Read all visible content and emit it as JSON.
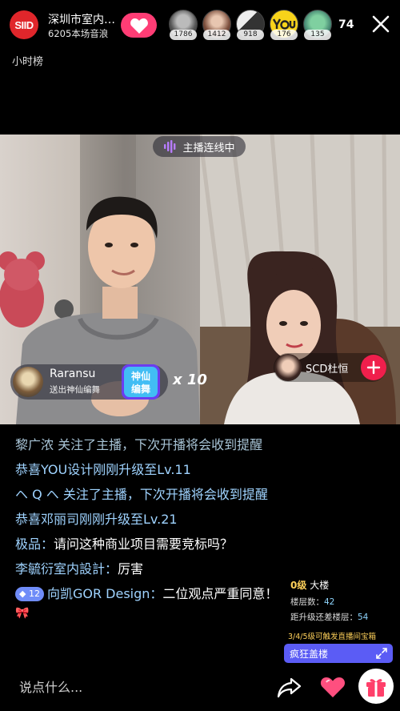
{
  "header": {
    "logo_text": "SIID",
    "host_name": "深圳市室内…",
    "host_sub": "6205本场音浪",
    "viewer_count": "74",
    "rank_label": "小时榜",
    "top_viewers": [
      {
        "badge": "1786",
        "icon": "avatar-user-1"
      },
      {
        "badge": "1412",
        "icon": "avatar-user-2"
      },
      {
        "badge": "918",
        "icon": "avatar-user-3"
      },
      {
        "badge": "176",
        "icon": "avatar-you-logo"
      },
      {
        "badge": "135",
        "icon": "avatar-user-5"
      }
    ]
  },
  "video": {
    "link_status": "主播连线中",
    "gift": {
      "sender": "Raransu",
      "desc": "送出神仙编舞",
      "gift_text": "神仙编舞",
      "count": "x 10"
    },
    "guest": {
      "name": "SCD杜恒"
    }
  },
  "chat": [
    {
      "name": "黎广浓 关注了主播，下次开播将会收到提醒",
      "text": "",
      "system": true,
      "dim": true
    },
    {
      "name": "恭喜YOU设计刚刚升级至Lv.11",
      "text": "",
      "system": true
    },
    {
      "name": "ヘ Q ヘ 关注了主播，下次开播将会收到提醒",
      "text": "",
      "system": true
    },
    {
      "name": "恭喜邓丽司刚刚升级至Lv.21",
      "text": "",
      "system": true
    },
    {
      "name": "极品：",
      "text": "请问这种商业项目需要竞标吗？",
      "system": false
    },
    {
      "name": "李毓衍室内設計：",
      "text": "厉害",
      "system": false
    },
    {
      "name": "向凯GOR Design：",
      "text": "二位观点严重同意！",
      "system": false,
      "level": "12"
    }
  ],
  "tower": {
    "level": "0级",
    "level_label": "大楼",
    "floors_label": "楼层数：",
    "floors_value": "42",
    "upgrade_label": "距升级还差楼层：",
    "upgrade_value": "54",
    "tip": "3/4/5级可触发直播间宝箱",
    "button": "疯狂盖楼"
  },
  "bottom": {
    "placeholder": "说点什么..."
  },
  "colors": {
    "accent_red": "#e0262b",
    "like_pink": "#ff3d75",
    "tower_blue": "#5b5cf5",
    "level_gold": "#ffd15a"
  }
}
